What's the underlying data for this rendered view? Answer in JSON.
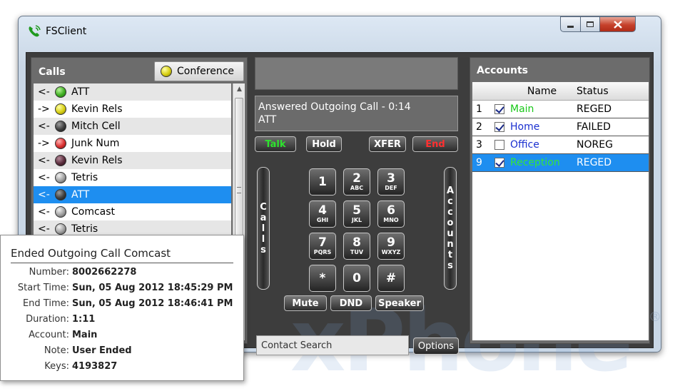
{
  "window": {
    "title": "FSClient"
  },
  "calls": {
    "title": "Calls",
    "conference_label": "Conference",
    "rows": [
      {
        "dir": "<-",
        "led": "green",
        "name": "ATT"
      },
      {
        "dir": "->",
        "led": "yellow",
        "name": "Kevin Rels"
      },
      {
        "dir": "<-",
        "led": "dark",
        "name": "Mitch Cell"
      },
      {
        "dir": "->",
        "led": "red",
        "name": "Junk Num"
      },
      {
        "dir": "<-",
        "led": "maroon",
        "name": "Kevin Rels"
      },
      {
        "dir": "<-",
        "led": "gray",
        "name": "Tetris"
      },
      {
        "dir": "<-",
        "led": "dark",
        "name": "ATT",
        "selected": true
      },
      {
        "dir": "<-",
        "led": "gray",
        "name": "Comcast"
      },
      {
        "dir": "<-",
        "led": "gray",
        "name": "Tetris"
      }
    ]
  },
  "status": {
    "line1": "Answered Outgoing Call - 0:14",
    "line2": "ATT"
  },
  "controls": {
    "talk": "Talk",
    "hold": "Hold",
    "xfer": "XFER",
    "end": "End",
    "mute": "Mute",
    "dnd": "DND",
    "speaker": "Speaker",
    "calls_side": "Calls",
    "accounts_side": "Accounts"
  },
  "keypad": [
    {
      "digit": "1",
      "letters": ""
    },
    {
      "digit": "2",
      "letters": "ABC"
    },
    {
      "digit": "3",
      "letters": "DEF"
    },
    {
      "digit": "4",
      "letters": "GHI"
    },
    {
      "digit": "5",
      "letters": "JKL"
    },
    {
      "digit": "6",
      "letters": "MNO"
    },
    {
      "digit": "7",
      "letters": "PQRS"
    },
    {
      "digit": "8",
      "letters": "TUV"
    },
    {
      "digit": "9",
      "letters": "WXYZ"
    },
    {
      "digit": "*",
      "letters": ""
    },
    {
      "digit": "0",
      "letters": ""
    },
    {
      "digit": "#",
      "letters": ""
    }
  ],
  "search": {
    "placeholder": "Contact Search"
  },
  "options_label": "Options",
  "accounts": {
    "title": "Accounts",
    "headers": {
      "name": "Name",
      "status": "Status"
    },
    "rows": [
      {
        "num": "1",
        "checked": true,
        "name": "Main",
        "name_color": "#18c818",
        "status": "REGED",
        "selected": false
      },
      {
        "num": "2",
        "checked": true,
        "name": "Home",
        "name_color": "#1a2fd0",
        "status": "FAILED",
        "selected": false
      },
      {
        "num": "3",
        "checked": false,
        "name": "Office",
        "name_color": "#1a2fd0",
        "status": "NOREG",
        "selected": false
      },
      {
        "num": "9",
        "checked": true,
        "name": "Reception",
        "name_color": "#37e637",
        "status": "REGED",
        "selected": true
      }
    ]
  },
  "tooltip": {
    "title": "Ended Outgoing Call Comcast",
    "rows": [
      {
        "label": "Number:",
        "value": "8002662278"
      },
      {
        "label": "Start Time:",
        "value": "Sun, 05 Aug 2012 18:45:29 PM"
      },
      {
        "label": "End Time:",
        "value": "Sun, 05 Aug 2012 18:46:41 PM"
      },
      {
        "label": "Duration:",
        "value": "1:11"
      },
      {
        "label": "Account:",
        "value": "Main"
      },
      {
        "label": "Note:",
        "value": "User Ended"
      },
      {
        "label": "Keys:",
        "value": "4193827"
      }
    ]
  },
  "watermark": "xPhone",
  "watermark_reg": "®"
}
